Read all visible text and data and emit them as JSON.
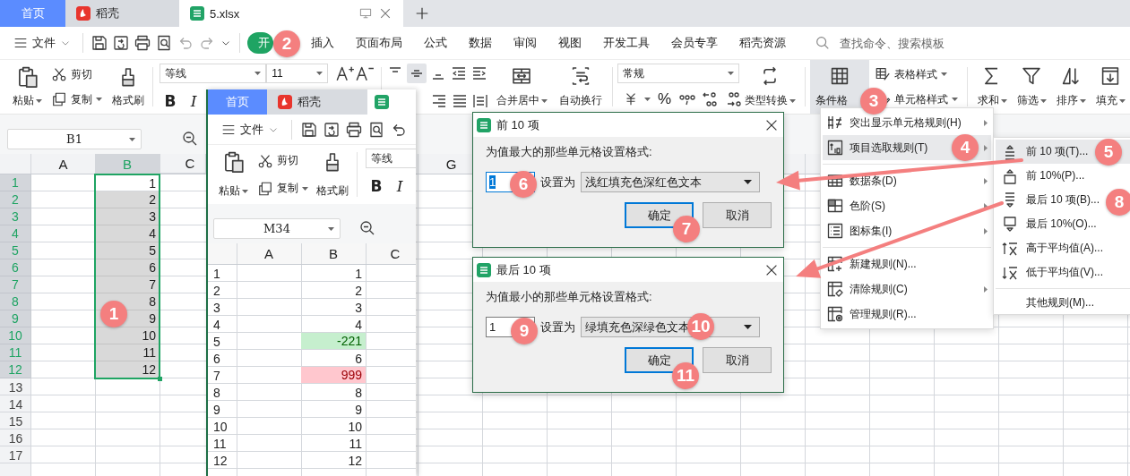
{
  "tabs": [
    {
      "label": "首页",
      "kind": "home",
      "selected": false
    },
    {
      "label": "稻壳",
      "kind": "docer",
      "selected": false
    },
    {
      "label": "5.xlsx",
      "kind": "sheet",
      "selected": true
    }
  ],
  "menu": {
    "file": "文件",
    "tabs": [
      {
        "label": "开",
        "selected": true
      },
      {
        "label": "插入",
        "selected": false
      },
      {
        "label": "页面布局",
        "selected": false
      },
      {
        "label": "公式",
        "selected": false
      },
      {
        "label": "数据",
        "selected": false
      },
      {
        "label": "审阅",
        "selected": false
      },
      {
        "label": "视图",
        "selected": false
      },
      {
        "label": "开发工具",
        "selected": false
      },
      {
        "label": "会员专享",
        "selected": false
      },
      {
        "label": "稻壳资源",
        "selected": false
      }
    ],
    "search": {
      "placeholder": "查找命令、搜索模板"
    }
  },
  "ribbon": {
    "paste": "粘贴",
    "cut": "剪切",
    "copy": "复制",
    "format_painter": "格式刷",
    "font": "等线",
    "font_size": "11",
    "bold": "B",
    "italic": "I",
    "merge": "合并居中",
    "wrap": "自动换行",
    "number_format": "常规",
    "percent": "%",
    "convert": "类型转换",
    "conditional_format": {
      "label": "条件格",
      "selected": true
    },
    "table_style": "表格样式",
    "cell_style": "单元格样式",
    "sum": "求和",
    "filter": "筛选",
    "sort": "排序",
    "fill": "填充"
  },
  "sheet": {
    "name_box": "B1",
    "columns": [
      {
        "label": "A",
        "selected": false
      },
      {
        "label": "B",
        "selected": true
      },
      {
        "label": "C",
        "selected": false
      }
    ],
    "far_columns": [
      {
        "label": "G",
        "selected": false
      }
    ],
    "rows": [
      {
        "label": "1",
        "selected": true,
        "active": true,
        "b": "1"
      },
      {
        "label": "2",
        "selected": true,
        "active": false,
        "b": "2"
      },
      {
        "label": "3",
        "selected": true,
        "active": false,
        "b": "3"
      },
      {
        "label": "4",
        "selected": true,
        "active": false,
        "b": "4"
      },
      {
        "label": "5",
        "selected": true,
        "active": false,
        "b": "5"
      },
      {
        "label": "6",
        "selected": true,
        "active": false,
        "b": "6"
      },
      {
        "label": "7",
        "selected": true,
        "active": false,
        "b": "7"
      },
      {
        "label": "8",
        "selected": true,
        "active": false,
        "b": "8"
      },
      {
        "label": "9",
        "selected": true,
        "active": false,
        "b": "9"
      },
      {
        "label": "10",
        "selected": true,
        "active": false,
        "b": "10"
      },
      {
        "label": "11",
        "selected": true,
        "active": false,
        "b": "11"
      },
      {
        "label": "12",
        "selected": true,
        "active": false,
        "b": "12"
      },
      {
        "label": "13",
        "selected": false
      },
      {
        "label": "14",
        "selected": false
      },
      {
        "label": "15",
        "selected": false
      },
      {
        "label": "16",
        "selected": false
      },
      {
        "label": "17",
        "selected": false
      }
    ]
  },
  "inner_window": {
    "tabs": [
      {
        "label": "首页",
        "kind": "home",
        "selected": false
      },
      {
        "label": "稻壳",
        "kind": "docer",
        "selected": false
      },
      {
        "kind": "sheet",
        "selected": true
      }
    ],
    "file": "文件",
    "paste": "粘贴",
    "cut": "剪切",
    "copy": "复制",
    "format_painter": "格式刷",
    "font": "等线",
    "bold": "B",
    "italic": "I",
    "name_box": "M34",
    "columns": [
      "A",
      "B",
      "C"
    ],
    "rows": [
      {
        "label": "1",
        "b": "1",
        "kind": "plain"
      },
      {
        "label": "2",
        "b": "2",
        "kind": "plain"
      },
      {
        "label": "3",
        "b": "3",
        "kind": "plain"
      },
      {
        "label": "4",
        "b": "4",
        "kind": "plain"
      },
      {
        "label": "5",
        "b": "-221",
        "kind": "low"
      },
      {
        "label": "6",
        "b": "6",
        "kind": "plain"
      },
      {
        "label": "7",
        "b": "999",
        "kind": "high"
      },
      {
        "label": "8",
        "b": "8",
        "kind": "plain"
      },
      {
        "label": "9",
        "b": "9",
        "kind": "plain"
      },
      {
        "label": "10",
        "b": "10",
        "kind": "plain"
      },
      {
        "label": "11",
        "b": "11",
        "kind": "plain"
      },
      {
        "label": "12",
        "b": "12",
        "kind": "plain"
      }
    ]
  },
  "dialogs": [
    {
      "title": "前 10 项",
      "prompt": "为值最大的那些单元格设置格式:",
      "count": "1",
      "count_focused": true,
      "set_as": "设置为",
      "style": "浅红填充色深红色文本",
      "ok": "确定",
      "cancel": "取消"
    },
    {
      "title": "最后 10 项",
      "prompt": "为值最小的那些单元格设置格式:",
      "count": "1",
      "count_focused": false,
      "set_as": "设置为",
      "style": "绿填充色深绿色文本",
      "ok": "确定",
      "cancel": "取消"
    }
  ],
  "cond_menu": [
    {
      "label": "突出显示单元格规则(H)",
      "has_submenu": true,
      "selected": false,
      "separator_before": false
    },
    {
      "label": "项目选取规则(T)",
      "has_submenu": true,
      "selected": true,
      "separator_before": false
    },
    {
      "label": "数据条(D)",
      "has_submenu": true,
      "selected": false,
      "separator_before": true
    },
    {
      "label": "色阶(S)",
      "has_submenu": true,
      "selected": false,
      "separator_before": false
    },
    {
      "label": "图标集(I)",
      "has_submenu": true,
      "selected": false,
      "separator_before": false
    },
    {
      "label": "新建规则(N)...",
      "has_submenu": false,
      "selected": false,
      "separator_before": true
    },
    {
      "label": "清除规则(C)",
      "has_submenu": true,
      "selected": false,
      "separator_before": false
    },
    {
      "label": "管理规则(R)...",
      "has_submenu": false,
      "selected": false,
      "separator_before": false
    }
  ],
  "submenu": [
    {
      "label": "前 10 项(T)...",
      "selected": true,
      "separator_before": false
    },
    {
      "label": "前 10%(P)...",
      "selected": false,
      "separator_before": false
    },
    {
      "label": "最后 10 项(B)...",
      "selected": false,
      "separator_before": false
    },
    {
      "label": "最后 10%(O)...",
      "selected": false,
      "separator_before": false
    },
    {
      "label": "高于平均值(A)...",
      "selected": false,
      "separator_before": false
    },
    {
      "label": "低于平均值(V)...",
      "selected": false,
      "separator_before": false
    },
    {
      "label": "其他规则(M)...",
      "selected": false,
      "separator_before": true
    }
  ],
  "badges": [
    "1",
    "2",
    "3",
    "4",
    "5",
    "6",
    "7",
    "8",
    "9",
    "10",
    "11"
  ]
}
